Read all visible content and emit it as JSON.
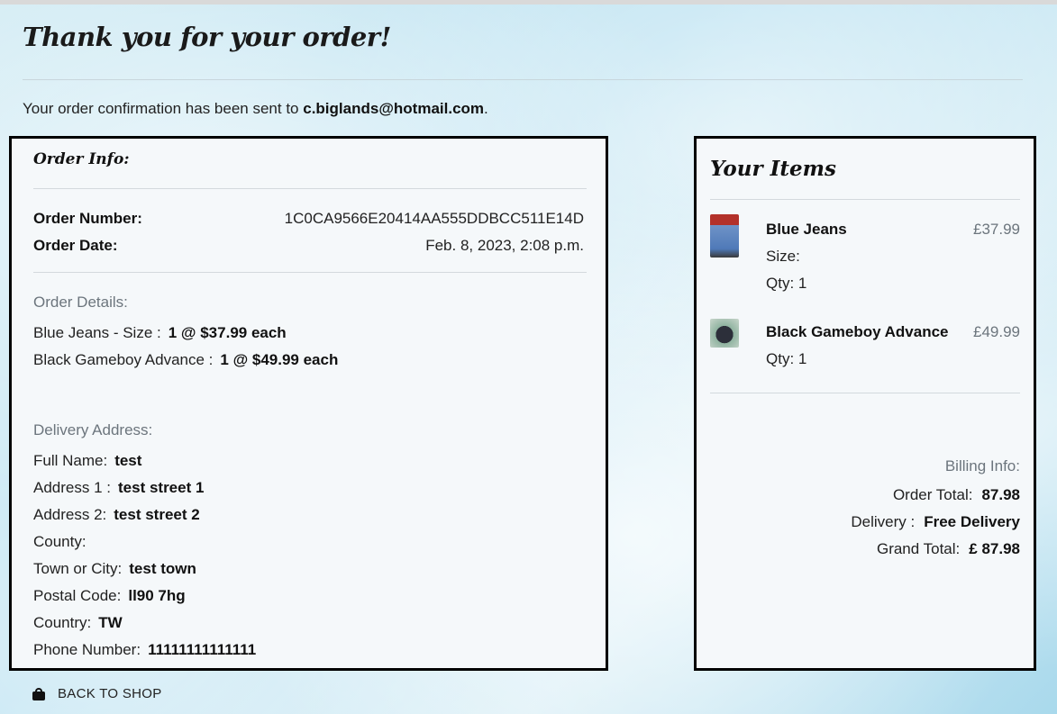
{
  "page": {
    "title": "Thank you for your order!",
    "confirmation_prefix": "Your order confirmation has been sent to",
    "email": "c.biglands@hotmail.com",
    "confirmation_suffix": "."
  },
  "order_info": {
    "heading": "Order Info:",
    "order_number_label": "Order Number:",
    "order_number": "1C0CA9566E20414AA555DDBCC511E14D",
    "order_date_label": "Order Date:",
    "order_date": "Feb. 8, 2023, 2:08 p.m.",
    "details_heading": "Order Details:",
    "details": [
      {
        "label": "Blue Jeans - Size :",
        "value": "1 @ $37.99 each"
      },
      {
        "label": "Black Gameboy Advance :",
        "value": "1 @ $49.99 each"
      }
    ],
    "address_heading": "Delivery Address:",
    "address": [
      {
        "label": "Full Name:",
        "value": "test"
      },
      {
        "label": "Address 1 :",
        "value": "test street 1"
      },
      {
        "label": "Address 2:",
        "value": "test street 2"
      },
      {
        "label": "County:",
        "value": ""
      },
      {
        "label": "Town or City:",
        "value": "test town"
      },
      {
        "label": "Postal Code:",
        "value": "ll90 7hg"
      },
      {
        "label": "Country:",
        "value": "TW"
      },
      {
        "label": "Phone Number:",
        "value": "11111111111111"
      }
    ]
  },
  "your_items": {
    "heading": "Your Items",
    "items": [
      {
        "name": "Blue Jeans",
        "price": "£37.99",
        "size_label": "Size:",
        "qty": "Qty: 1",
        "image_icon": "jeans-thumbnail"
      },
      {
        "name": "Black Gameboy Advance",
        "price": "£49.99",
        "qty": "Qty: 1",
        "image_icon": "gameboy-thumbnail"
      }
    ],
    "billing_heading": "Billing Info:",
    "order_total_label": "Order Total:",
    "order_total": "87.98",
    "delivery_label": "Delivery :",
    "delivery": "Free Delivery",
    "grand_total_label": "Grand Total:",
    "grand_total": "£ 87.98"
  },
  "footer": {
    "back_label": "BACK TO SHOP",
    "back_icon": "shopping-bag-icon"
  }
}
